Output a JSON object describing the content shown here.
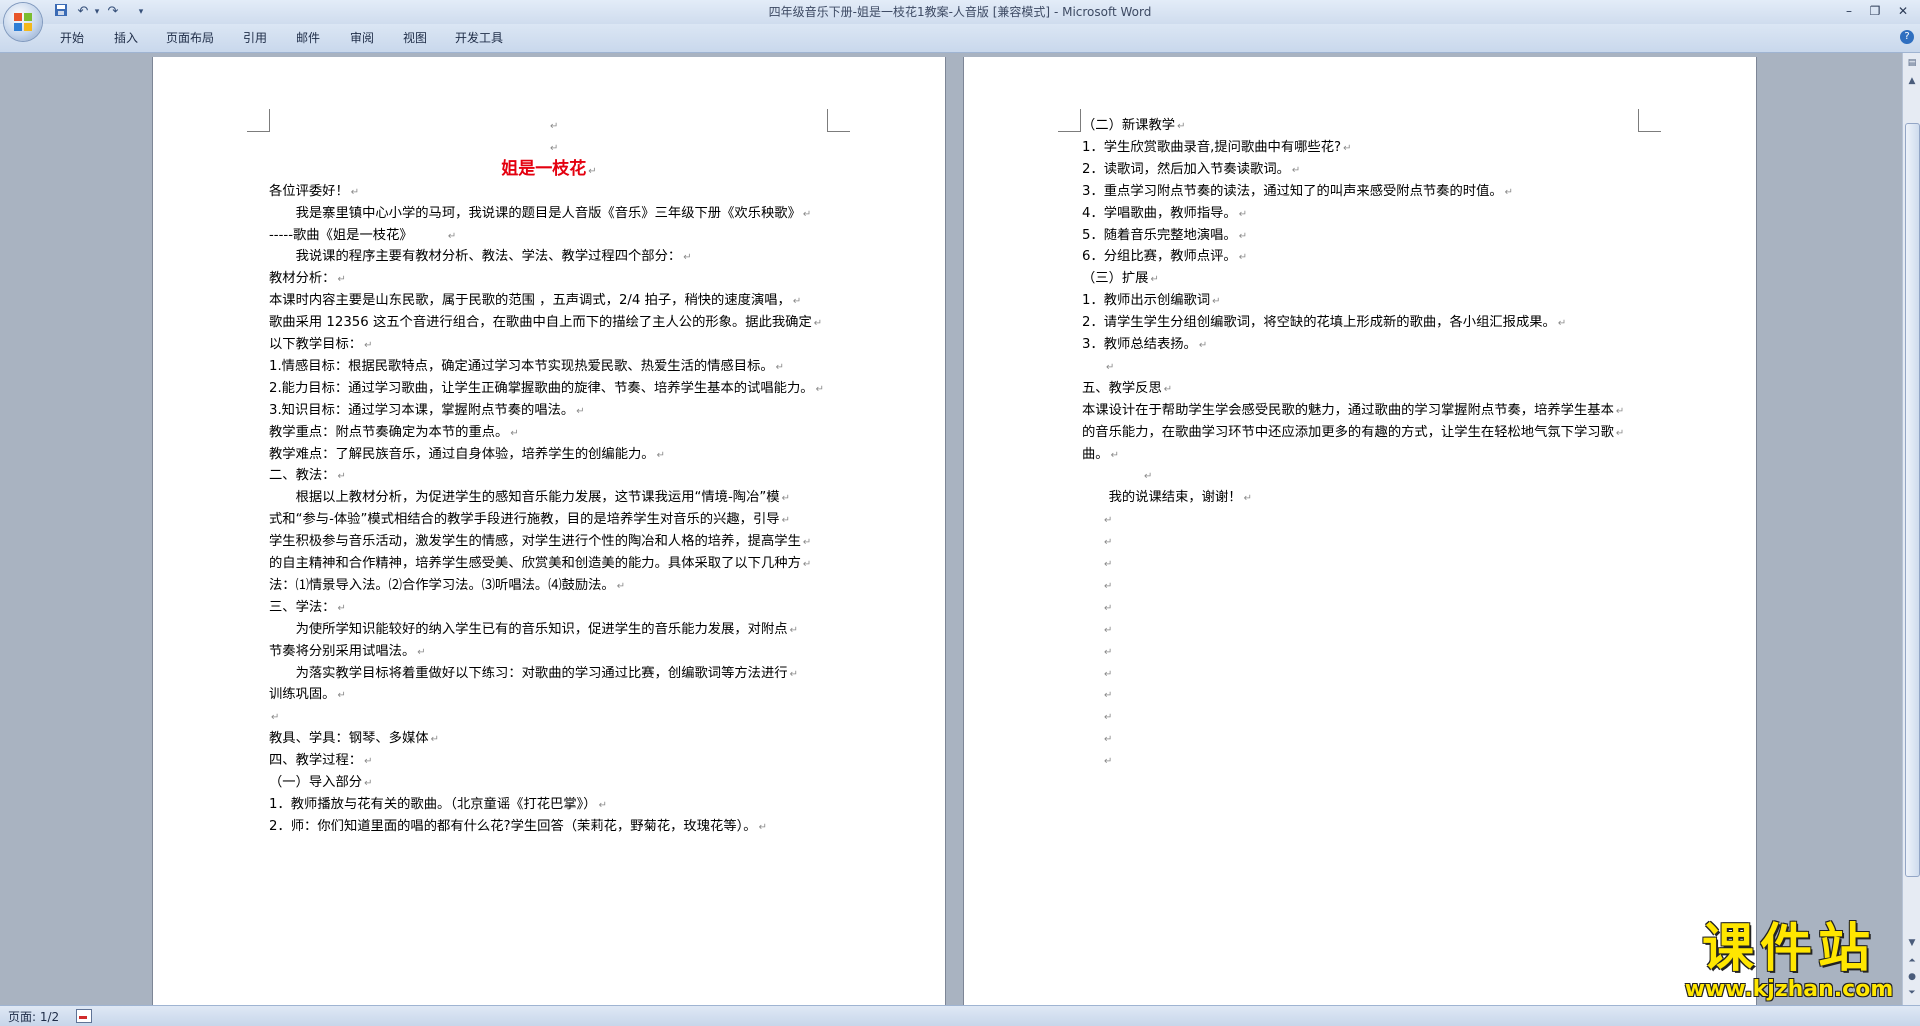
{
  "window": {
    "title": "四年级音乐下册-姐是一枝花1教案-人音版 [兼容模式]",
    "app_name": " - Microsoft Word"
  },
  "ribbon": {
    "tabs": [
      "开始",
      "插入",
      "页面布局",
      "引用",
      "邮件",
      "审阅",
      "视图",
      "开发工具"
    ]
  },
  "page1": {
    "lines": [
      "",
      "",
      "姐是一枝花",
      "各位评委好！",
      "　　我是寨里镇中心小学的马珂，我说课的题目是人音版《音乐》三年级下册《欢乐秧歌》",
      "-----歌曲《姐是一枝花》　　　",
      "　　我说课的程序主要有教材分析、教法、学法、教学过程四个部分：",
      "教材分析：",
      "本课时内容主要是山东民歌，属于民歌的范围 ，五声调式，2/4 拍子，稍快的速度演唱，",
      "歌曲采用 12356 这五个音进行组合，在歌曲中自上而下的描绘了主人公的形象。据此我确定",
      "以下教学目标：",
      "1.情感目标：根据民歌特点，确定通过学习本节实现热爱民歌、热爱生活的情感目标。",
      "2.能力目标：通过学习歌曲，让学生正确掌握歌曲的旋律、节奏、培养学生基本的试唱能力。",
      "3.知识目标：通过学习本课，掌握附点节奏的唱法。",
      "教学重点：附点节奏确定为本节的重点。",
      "教学难点：了解民族音乐，通过自身体验，培养学生的创编能力。",
      "二、教法：",
      "　　根据以上教材分析，为促进学生的感知音乐能力发展，这节课我运用“情境-陶冶”模",
      "式和“参与-体验”模式相结合的教学手段进行施教，目的是培养学生对音乐的兴趣，引导",
      "学生积极参与音乐活动，激发学生的情感，对学生进行个性的陶冶和人格的培养，提高学生",
      "的自主精神和合作精神，培养学生感受美、欣赏美和创造美的能力。具体采取了以下几种方",
      "法：⑴情景导入法。⑵合作学习法。⑶听唱法。⑷鼓励法。",
      "三、学法：",
      "　　为使所学知识能较好的纳入学生已有的音乐知识，促进学生的音乐能力发展，对附点",
      "节奏将分别采用试唱法。",
      "　　为落实教学目标将着重做好以下练习：对歌曲的学习通过比赛，创编歌词等方法进行",
      "训练巩固。",
      "",
      "教具、学具：钢琴、多媒体",
      "四、教学过程：",
      "（一）导入部分",
      "1．教师播放与花有关的歌曲。（北京童谣《打花巴掌》）",
      "2．师：你们知道里面的唱的都有什么花?学生回答（茉莉花，野菊花，玫瑰花等）。"
    ]
  },
  "page2": {
    "lines": [
      "（二）新课教学",
      "1．学生欣赏歌曲录音,提问歌曲中有哪些花?",
      "2．读歌词，然后加入节奏读歌词。",
      "3．重点学习附点节奏的读法，通过知了的叫声来感受附点节奏的时值。",
      "4．学唱歌曲，教师指导。",
      "5．随着音乐完整地演唱。",
      "6．分组比赛，教师点评。",
      "（三）扩展",
      "1．教师出示创编歌词",
      "2．请学生学生分组创编歌词，将空缺的花填上形成新的歌曲，各小组汇报成果。",
      "3．教师总结表扬。",
      "",
      "五、教学反思",
      "本课设计在于帮助学生学会感受民歌的魅力，通过歌曲的学习掌握附点节奏，培养学生基本",
      "的音乐能力，在歌曲学习环节中还应添加更多的有趣的方式，让学生在轻松地气氛下学习歌",
      "曲。",
      "",
      "　　我的说课结束，谢谢！",
      "",
      "",
      "",
      "",
      "",
      "",
      "",
      "",
      "",
      "",
      "",
      ""
    ]
  },
  "paragraph_mark": "↵",
  "status": {
    "page_info": "页面: 1/2"
  },
  "watermark": {
    "title": "课件站",
    "url": "www.kjzhan.com"
  },
  "colors": {
    "title_red": "#e4000f",
    "watermark_yellow": "#ffe600",
    "workspace": "#a9b3c1"
  }
}
